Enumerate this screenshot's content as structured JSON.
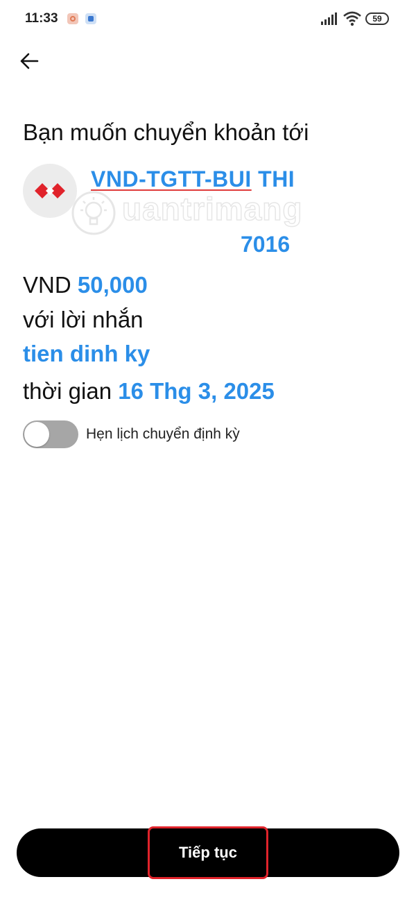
{
  "status_bar": {
    "time": "11:33",
    "battery_level": "59",
    "icons": [
      "app-notification-icon",
      "app-notification-icon",
      "signal-icon",
      "wifi-icon",
      "battery-icon"
    ]
  },
  "header": {
    "back_icon": "arrow-left-icon"
  },
  "transfer": {
    "heading": "Bạn muốn chuyển khoản tới",
    "recipient_name_part1": "VND-TGTT-BUI",
    "recipient_name_part2": " THI",
    "account_number": "7016",
    "currency": "VND",
    "amount": "50,000",
    "message_label": "với lời nhắn",
    "message": "tien dinh ky",
    "time_label": "thời gian",
    "date": "16 Thg 3, 2025"
  },
  "watermark": {
    "text": "uantrimang"
  },
  "schedule": {
    "label": "Hẹn lịch chuyển định kỳ",
    "enabled": false
  },
  "footer": {
    "continue_label": "Tiếp tục"
  },
  "colors": {
    "accent": "#2b8ee8",
    "button": "#000000",
    "highlight": "#e0232b",
    "bank_red": "#e0232b"
  }
}
